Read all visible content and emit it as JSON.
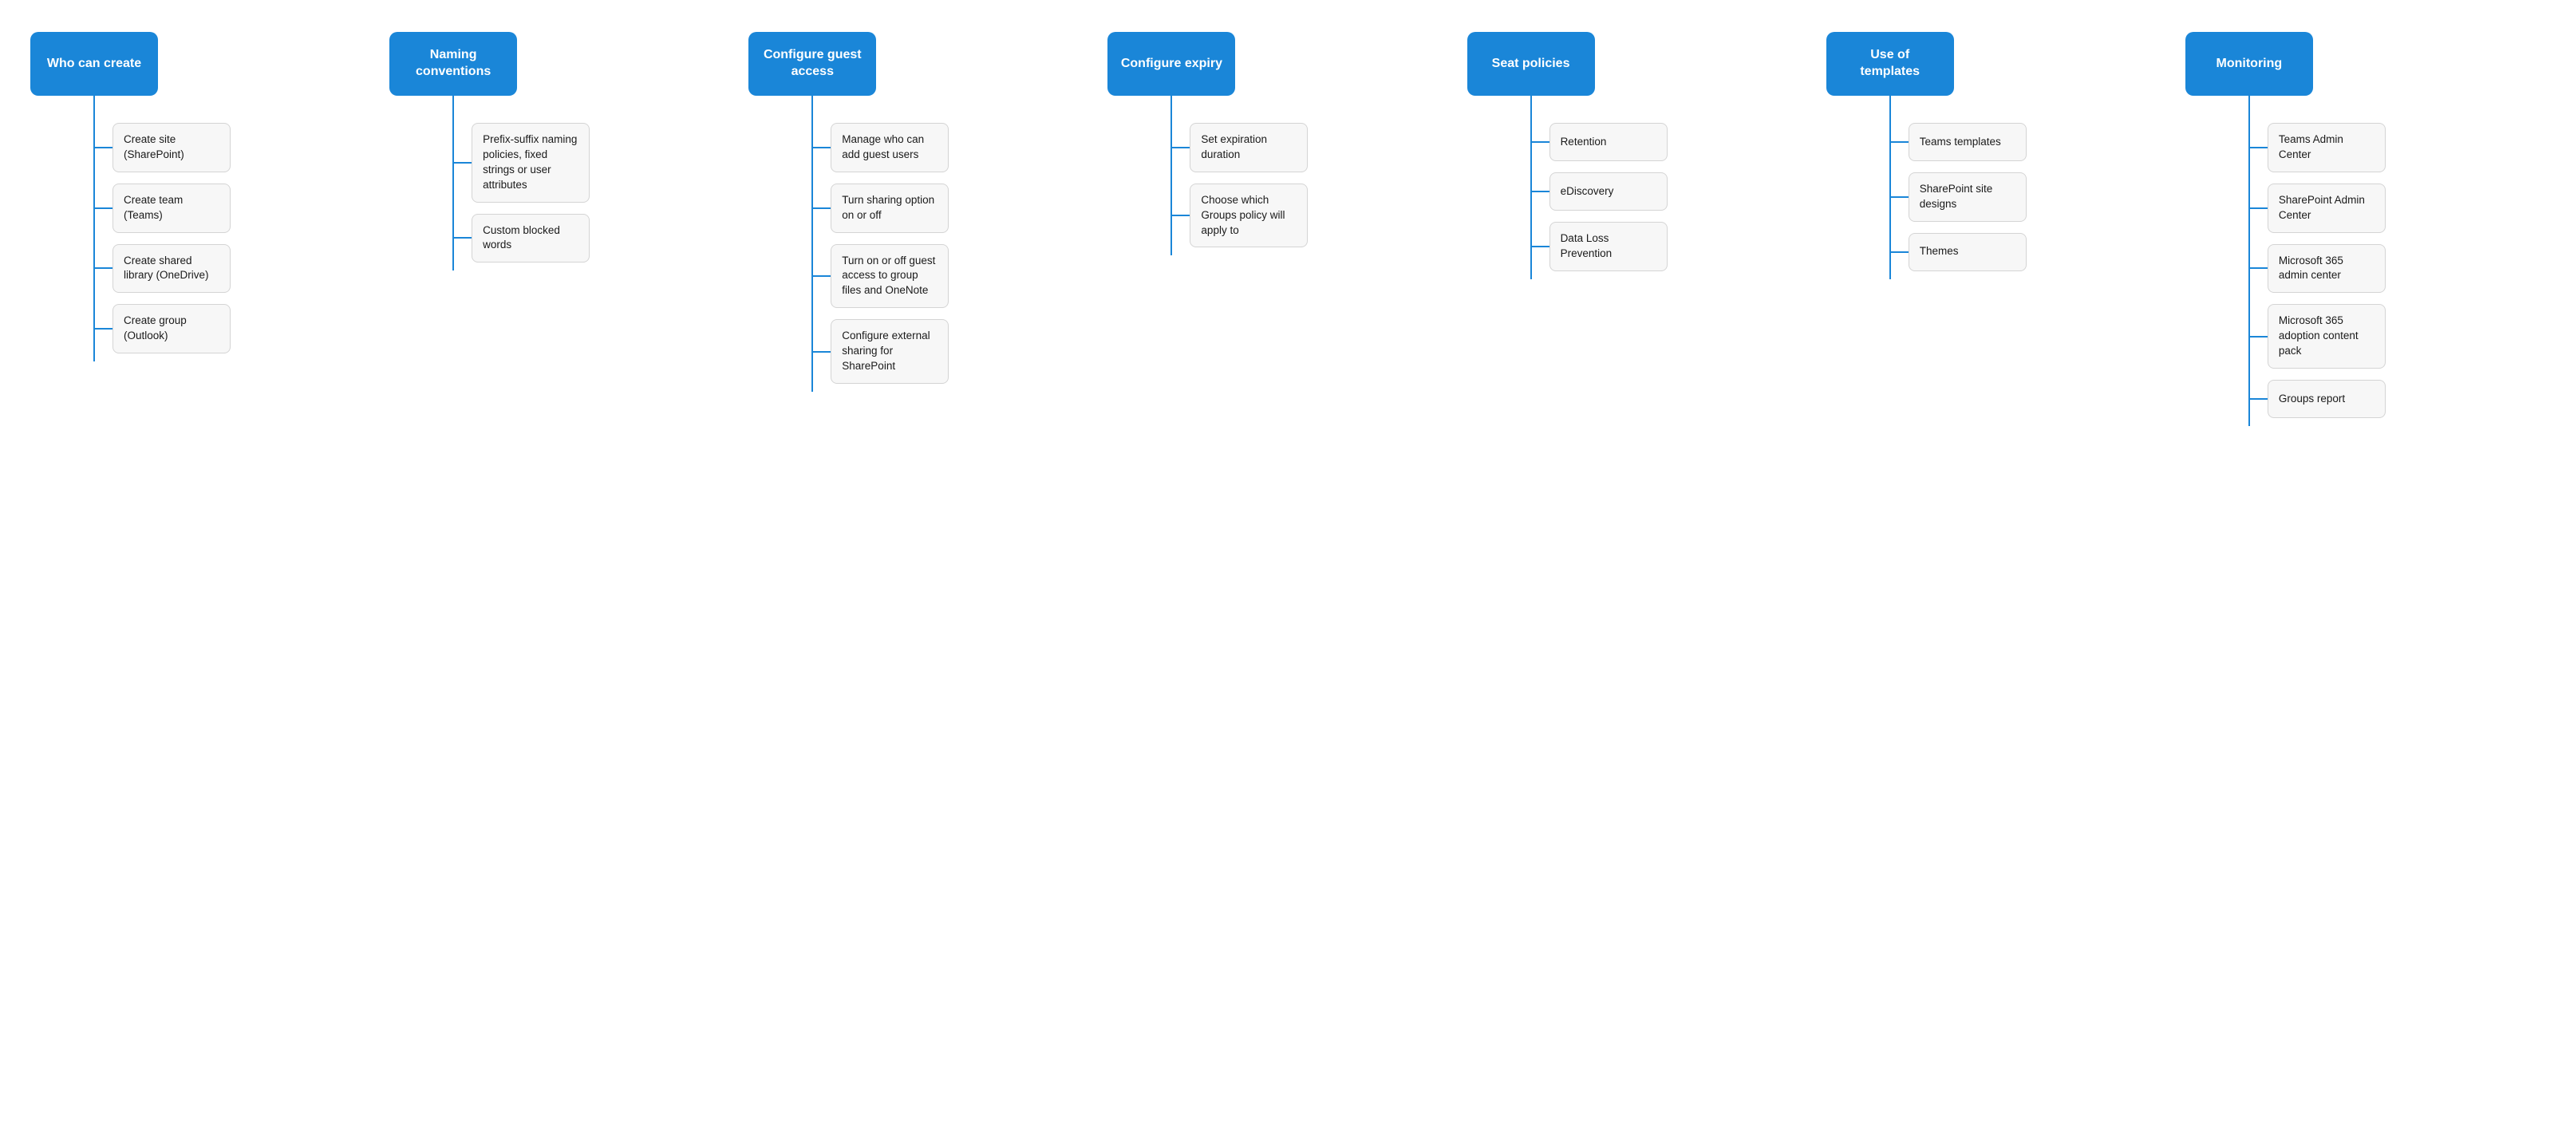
{
  "columns": [
    {
      "id": "who-can-create",
      "header": "Who can create",
      "items": [
        "Create site (SharePoint)",
        "Create team (Teams)",
        "Create shared library (OneDrive)",
        "Create group (Outlook)"
      ]
    },
    {
      "id": "naming-conventions",
      "header": "Naming conventions",
      "items": [
        "Prefix-suffix naming policies, fixed strings or user attributes",
        "Custom blocked words"
      ]
    },
    {
      "id": "configure-guest-access",
      "header": "Configure guest access",
      "items": [
        "Manage who can add guest users",
        "Turn sharing option on or off",
        "Turn on or off guest access to group files and OneNote",
        "Configure external sharing for SharePoint"
      ]
    },
    {
      "id": "configure-expiry",
      "header": "Configure expiry",
      "items": [
        "Set expiration duration",
        "Choose which Groups policy will apply to"
      ]
    },
    {
      "id": "seat-policies",
      "header": "Seat policies",
      "items": [
        "Retention",
        "eDiscovery",
        "Data Loss Prevention"
      ]
    },
    {
      "id": "use-of-templates",
      "header": "Use of templates",
      "items": [
        "Teams templates",
        "SharePoint site designs",
        "Themes"
      ]
    },
    {
      "id": "monitoring",
      "header": "Monitoring",
      "items": [
        "Teams Admin Center",
        "SharePoint Admin Center",
        "Microsoft 365 admin center",
        "Microsoft 365 adoption content pack",
        "Groups report"
      ]
    }
  ]
}
